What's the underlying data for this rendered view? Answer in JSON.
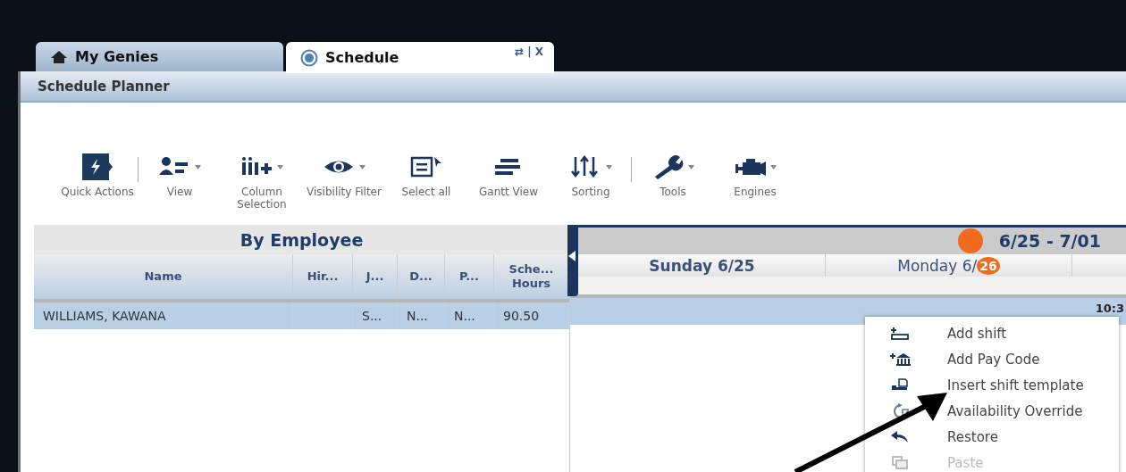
{
  "tabs": [
    {
      "label": "My Genies",
      "selected": false
    },
    {
      "label": "Schedule",
      "selected": true,
      "actions": "⇄ | X"
    }
  ],
  "window": {
    "title": "Schedule Planner"
  },
  "toolbar": [
    {
      "label": "Quick Actions",
      "dropdown": false,
      "separator_after": true
    },
    {
      "label": "View",
      "dropdown": true,
      "separator_after": false
    },
    {
      "label": "Column Selection",
      "dropdown": true,
      "separator_after": false
    },
    {
      "label": "Visibility Filter",
      "dropdown": true,
      "separator_after": false
    },
    {
      "label": "Select all",
      "dropdown": false,
      "separator_after": false
    },
    {
      "label": "Gantt View",
      "dropdown": false,
      "separator_after": false
    },
    {
      "label": "Sorting",
      "dropdown": true,
      "separator_after": true
    },
    {
      "label": "Tools",
      "dropdown": true,
      "separator_after": false
    },
    {
      "label": "Engines",
      "dropdown": true,
      "separator_after": false
    }
  ],
  "grid": {
    "title": "By Employee",
    "columns": [
      "Name",
      "Hir...",
      "J...",
      "D...",
      "P...",
      "Sche... Hours"
    ],
    "rows": [
      {
        "selected": true,
        "cells": [
          "WILLIAMS, KAWANA",
          "",
          "S...",
          "N...",
          "N...",
          "90.50"
        ]
      }
    ]
  },
  "calendar": {
    "range": "6/25 - 7/01",
    "days": [
      {
        "label": "Sunday 6/25",
        "selected": true
      },
      {
        "label": "Monday 6/",
        "badge": "26",
        "selected": false
      }
    ],
    "row_time": "10:3"
  },
  "context_menu": [
    {
      "label": "Add shift",
      "disabled": false
    },
    {
      "label": "Add Pay Code",
      "disabled": false
    },
    {
      "label": "Insert shift template",
      "disabled": false
    },
    {
      "label": "Availability Override",
      "disabled": false
    },
    {
      "label": "Restore",
      "disabled": false
    },
    {
      "label": "Paste",
      "disabled": true
    }
  ]
}
